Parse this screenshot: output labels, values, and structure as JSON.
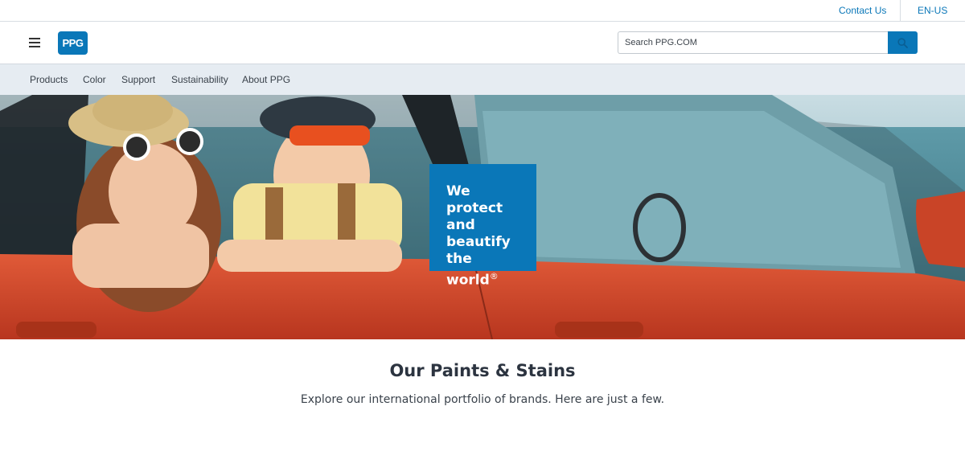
{
  "utility": {
    "contact_label": "Contact Us",
    "language_label": "EN-US"
  },
  "header": {
    "logo_text": "PPG",
    "search_placeholder": "Search PPG.COM"
  },
  "nav": {
    "items": [
      {
        "label": "Products"
      },
      {
        "label": "Color"
      },
      {
        "label": "Support"
      },
      {
        "label": "Sustainability"
      },
      {
        "label": "About PPG"
      }
    ]
  },
  "hero": {
    "tagline_lines": [
      "We protect",
      "and",
      "beautify",
      "the world"
    ],
    "tagline_mark": "®"
  },
  "section": {
    "title": "Our Paints & Stains",
    "subtitle": "Explore our international portfolio of brands. Here are just a few."
  },
  "colors": {
    "brand_blue": "#0a77b8",
    "nav_bg": "#e6ecf2",
    "car_red": "#d8492c"
  }
}
